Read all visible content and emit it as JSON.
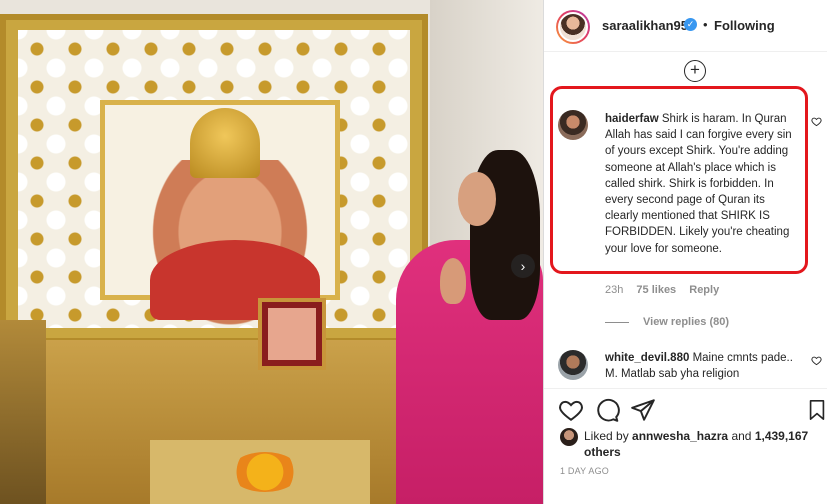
{
  "header": {
    "username": "saraalikhan95",
    "separator": "•",
    "follow_status": "Following"
  },
  "comments": [
    {
      "username": "haiderfaw",
      "text": "Shirk is haram. In Quran Allah has said I can forgive every sin of yours except Shirk. You're adding someone at Allah's place which is called shirk. Shirk is forbidden. In every second page of Quran its clearly mentioned that SHIRK IS FORBIDDEN. Likely you're cheating your love for someone.",
      "time": "23h",
      "likes": "75 likes",
      "reply_label": "Reply",
      "view_replies": "View replies (80)"
    },
    {
      "username": "white_devil.880",
      "text": "Maine cmnts pade.. M. Matlab sab yha religion"
    }
  ],
  "likes": {
    "prefix": "Liked by",
    "user": "annwesha_hazra",
    "connector": "and",
    "others": "1,439,167 others"
  },
  "time_ago": "1 DAY AGO",
  "icons": {
    "verified": "verified-badge-icon",
    "load_more": "plus-circle-icon",
    "like": "heart-icon",
    "comment": "comment-bubble-icon",
    "share": "paper-plane-icon",
    "save": "bookmark-icon",
    "next": "chevron-right-icon"
  },
  "colors": {
    "highlight_border": "#e3171d",
    "verified": "#3897f0",
    "muted_text": "#8e8e8e"
  }
}
